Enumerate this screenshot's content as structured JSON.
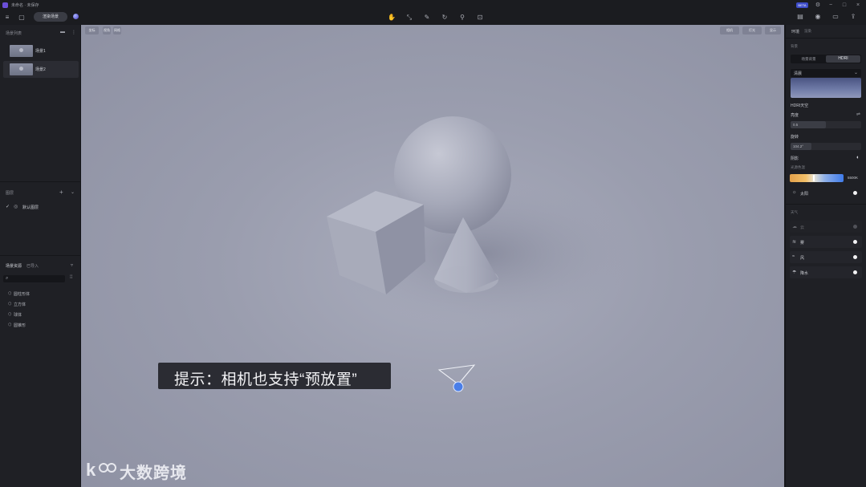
{
  "window": {
    "title": "未命名 · 未保存",
    "beta_badge": "BETA",
    "controls": [
      "−",
      "□",
      "×"
    ]
  },
  "toolbar": {
    "render_label": "渲染场景",
    "center_tools": [
      "select-tool-icon",
      "scale-tool-icon",
      "brush-tool-icon",
      "rotate-tool-icon",
      "physics-tool-icon",
      "frame-tool-icon"
    ],
    "right_tools": [
      "gallery-icon",
      "camera-icon",
      "video-icon",
      "export-icon"
    ]
  },
  "left_panel": {
    "scenes_header": "场景列表",
    "scenes": [
      {
        "label": "场景1"
      },
      {
        "label": "场景2"
      }
    ],
    "layers_header": "图层",
    "layers": [
      {
        "label": "默认图层"
      }
    ],
    "assets_tabs": [
      "场景资源",
      "已导入"
    ],
    "search_placeholder": "",
    "assets": [
      {
        "label": "圆柱形体"
      },
      {
        "label": "立方体"
      },
      {
        "label": "球体"
      },
      {
        "label": "圆锥形"
      }
    ]
  },
  "viewport": {
    "left_tools": [
      "坐标",
      "视角",
      "网格"
    ],
    "right_tools": [
      "相机",
      "灯光",
      "显示"
    ],
    "subtitle": "提示：相机也支持“预放置”",
    "watermark": "大数跨境"
  },
  "right_panel": {
    "tabs": [
      "环境",
      "渲染"
    ],
    "section_title": "背景",
    "bg_options": [
      "场景背景",
      "HDRI"
    ],
    "preset_label": "清晨",
    "group_label": "HDRI天空",
    "brightness_label": "亮度",
    "brightness_value": "0.5",
    "brightness_fraction": 0.5,
    "rotation_label": "旋转",
    "rotation_value": "104.2°",
    "rotation_fraction": 0.3,
    "shadow_label": "阴影",
    "temp_label": "光源色温",
    "temp_value": "5500K",
    "sun_label": "太阳",
    "weather_header": "天气",
    "weather": [
      {
        "label": "云",
        "icon": "cloud-icon",
        "disabled": true
      },
      {
        "label": "雾",
        "icon": "fog-icon"
      },
      {
        "label": "风",
        "icon": "wind-icon"
      },
      {
        "label": "降水",
        "icon": "rain-icon"
      }
    ]
  }
}
